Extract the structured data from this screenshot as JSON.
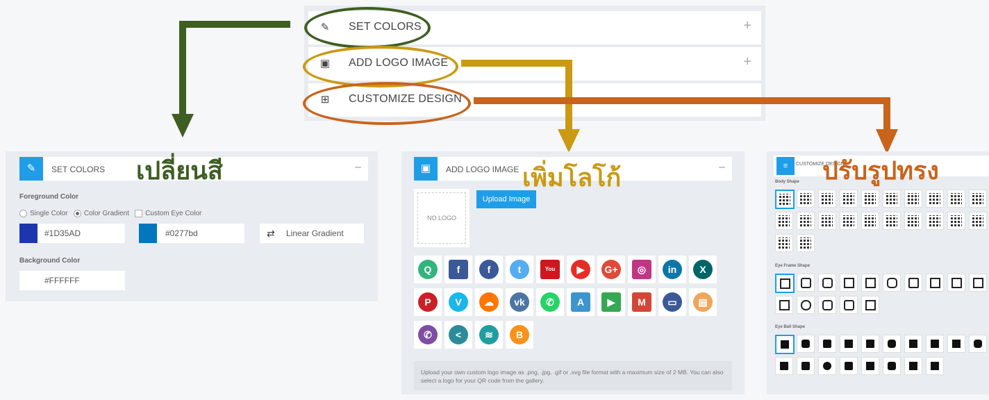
{
  "accordion": [
    {
      "icon": "brush-icon",
      "label": "SET COLORS",
      "toggle": "+"
    },
    {
      "icon": "image-icon",
      "label": "ADD LOGO IMAGE",
      "toggle": "+"
    },
    {
      "icon": "qr-icon",
      "label": "CUSTOMIZE DESIGN",
      "toggle": ""
    }
  ],
  "annotations": {
    "set_colors": "เปลี่ยนสี",
    "add_logo": "เพิ่มโลโก้",
    "customize": "ปรับรูปทรง"
  },
  "colors": {
    "accent": "#1e9ee8",
    "green": "#3f5e22",
    "gold": "#c99a12",
    "orange": "#c8641c",
    "foreground": "#1D35AD",
    "foreground2": "#0277bd"
  },
  "set_colors_panel": {
    "title": "SET COLORS",
    "toggle": "–",
    "foreground_label": "Foreground Color",
    "options": [
      "Single Color",
      "Color Gradient",
      "Custom Eye Color"
    ],
    "color1": "#1D35AD",
    "color2": "#0277bd",
    "gradient_type": "Linear Gradient",
    "background_label": "Background Color",
    "background_value": "#FFFFFF"
  },
  "logo_panel": {
    "title": "ADD LOGO IMAGE",
    "toggle": "–",
    "no_logo": "NO LOGO",
    "upload_button": "Upload Image",
    "help_text": "Upload your own custom logo image as .png, .jpg, .gif or .svg file format with a maximum size of 2 MB. You can also select a logo for your QR code from the gallery.",
    "logos": [
      {
        "name": "messenger-logo-icon",
        "glyph": "Q",
        "color": "#33b37e",
        "round": true
      },
      {
        "name": "facebook-square-icon",
        "glyph": "f",
        "color": "#3b5998",
        "round": false
      },
      {
        "name": "facebook-round-icon",
        "glyph": "f",
        "color": "#3b5998",
        "round": true
      },
      {
        "name": "twitter-icon",
        "glyph": "t",
        "color": "#55acee",
        "round": true
      },
      {
        "name": "youtube-square-icon",
        "glyph": "You",
        "color": "#cc181e",
        "round": false
      },
      {
        "name": "youtube-round-icon",
        "glyph": "▶",
        "color": "#e52d27",
        "round": true
      },
      {
        "name": "google-plus-icon",
        "glyph": "G+",
        "color": "#dd4b39",
        "round": true
      },
      {
        "name": "instagram-icon",
        "glyph": "◎",
        "color": "#c13584",
        "round": false
      },
      {
        "name": "linkedin-icon",
        "glyph": "in",
        "color": "#0e76a8",
        "round": true
      },
      {
        "name": "xing-icon",
        "glyph": "X",
        "color": "#006567",
        "round": true
      },
      {
        "name": "pinterest-icon",
        "glyph": "P",
        "color": "#cb2027",
        "round": true
      },
      {
        "name": "vimeo-icon",
        "glyph": "V",
        "color": "#1ab7ea",
        "round": true
      },
      {
        "name": "soundcloud-icon",
        "glyph": "☁",
        "color": "#ff7700",
        "round": true
      },
      {
        "name": "vk-icon",
        "glyph": "vk",
        "color": "#4c75a3",
        "round": true
      },
      {
        "name": "whatsapp-icon",
        "glyph": "✆",
        "color": "#25d366",
        "round": true
      },
      {
        "name": "app-store-icon",
        "glyph": "A",
        "color": "#3d95ce",
        "round": false
      },
      {
        "name": "google-play-icon",
        "glyph": "▶",
        "color": "#34a853",
        "round": false
      },
      {
        "name": "gmail-icon",
        "glyph": "M",
        "color": "#d44638",
        "round": false
      },
      {
        "name": "chat-icon",
        "glyph": "▭",
        "color": "#3b5998",
        "round": true
      },
      {
        "name": "document-icon",
        "glyph": "▤",
        "color": "#f0a65a",
        "round": true
      },
      {
        "name": "viber-icon",
        "glyph": "✆",
        "color": "#7d4ea3",
        "round": true
      },
      {
        "name": "share-icon",
        "glyph": "<",
        "color": "#2c8c99",
        "round": true
      },
      {
        "name": "wifi-icon",
        "glyph": "≋",
        "color": "#1e9ea0",
        "round": true
      },
      {
        "name": "bitcoin-icon",
        "glyph": "B",
        "color": "#f7931a",
        "round": true
      }
    ]
  },
  "design_panel": {
    "title": "CUSTOMIZE DESIGN",
    "toggle": "–",
    "body_label": "Body Shape",
    "frame_label": "Eye Frame Shape",
    "ball_label": "Eye Ball Shape",
    "body_count": 22,
    "frame_count": 15,
    "ball_count": 18
  }
}
